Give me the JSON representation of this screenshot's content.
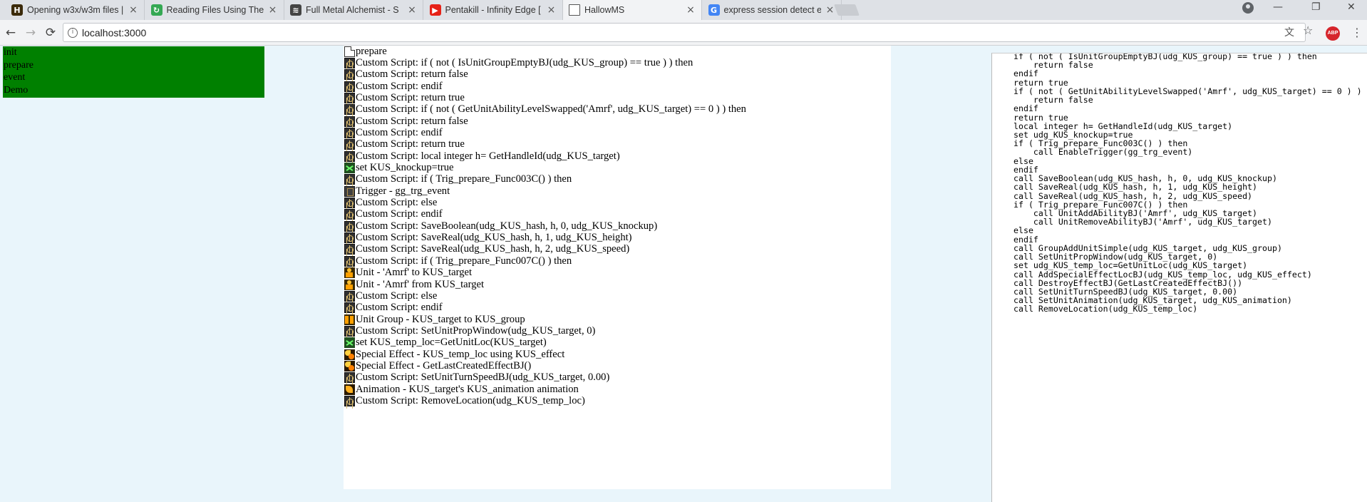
{
  "browser": {
    "tabs": [
      {
        "title": "Opening w3x/w3m files |",
        "favicon": "hive-icon",
        "color": "#3b2a0a",
        "glyph": "H",
        "active": false
      },
      {
        "title": "Reading Files Using The I",
        "favicon": "refresh-green-icon",
        "color": "#34a853",
        "glyph": "↻",
        "active": false
      },
      {
        "title": "Full Metal Alchemist - S",
        "favicon": "stack-icon",
        "color": "#444444",
        "glyph": "≋",
        "active": false
      },
      {
        "title": "Pentakill - Infinity Edge [",
        "favicon": "youtube-icon",
        "color": "#e62117",
        "glyph": "▶",
        "active": false
      },
      {
        "title": "HallowMS",
        "favicon": "document-icon",
        "color": "#ffffff",
        "glyph": "",
        "active": true
      },
      {
        "title": "express session detect er",
        "favicon": "google-icon",
        "color": "#4285f4",
        "glyph": "G",
        "active": false
      }
    ],
    "close_glyph": "×",
    "url": "localhost:3000",
    "back_glyph": "←",
    "forward_glyph": "→",
    "reload_glyph": "⟳",
    "translate_glyph": "文",
    "star_glyph": "☆",
    "abp_label": "ABP",
    "menu_glyph": "⋮",
    "minimize_glyph": "—",
    "restore_glyph": "❐",
    "window_close_glyph": "✕"
  },
  "trigger_menu": {
    "items": [
      "init",
      "prepare",
      "event",
      "Demo"
    ]
  },
  "actions": [
    {
      "icon": "page",
      "text": "prepare"
    },
    {
      "icon": "script",
      "text": "Custom Script: if ( not ( IsUnitGroupEmptyBJ(udg_KUS_group) == true ) ) then"
    },
    {
      "icon": "script",
      "text": "Custom Script: return false"
    },
    {
      "icon": "script",
      "text": "Custom Script: endif"
    },
    {
      "icon": "script",
      "text": "Custom Script: return true"
    },
    {
      "icon": "script",
      "text": "Custom Script: if ( not ( GetUnitAbilityLevelSwapped('Amrf', udg_KUS_target) == 0 ) ) then"
    },
    {
      "icon": "script",
      "text": "Custom Script: return false"
    },
    {
      "icon": "script",
      "text": "Custom Script: endif"
    },
    {
      "icon": "script",
      "text": "Custom Script: return true"
    },
    {
      "icon": "script",
      "text": "Custom Script: local integer h= GetHandleId(udg_KUS_target)"
    },
    {
      "icon": "setvar",
      "text": " set KUS_knockup=true"
    },
    {
      "icon": "script",
      "text": "Custom Script: if ( Trig_prepare_Func003C() ) then"
    },
    {
      "icon": "trigger",
      "text": "Trigger - gg_trg_event"
    },
    {
      "icon": "script",
      "text": "Custom Script: else"
    },
    {
      "icon": "script",
      "text": "Custom Script: endif"
    },
    {
      "icon": "script",
      "text": "Custom Script: SaveBoolean(udg_KUS_hash, h, 0, udg_KUS_knockup)"
    },
    {
      "icon": "script",
      "text": "Custom Script: SaveReal(udg_KUS_hash, h, 1, udg_KUS_height)"
    },
    {
      "icon": "script",
      "text": "Custom Script: SaveReal(udg_KUS_hash, h, 2, udg_KUS_speed)"
    },
    {
      "icon": "script",
      "text": "Custom Script: if ( Trig_prepare_Func007C() ) then"
    },
    {
      "icon": "unit",
      "text": "Unit - 'Amrf' to KUS_target"
    },
    {
      "icon": "unit",
      "text": "Unit - 'Amrf' from KUS_target"
    },
    {
      "icon": "script",
      "text": "Custom Script: else"
    },
    {
      "icon": "script",
      "text": "Custom Script: endif"
    },
    {
      "icon": "group",
      "text": "Unit Group - KUS_target to KUS_group"
    },
    {
      "icon": "script",
      "text": "Custom Script: SetUnitPropWindow(udg_KUS_target, 0)"
    },
    {
      "icon": "setvar",
      "text": " set KUS_temp_loc=GetUnitLoc(KUS_target)"
    },
    {
      "icon": "effect",
      "text": "Special Effect - KUS_temp_loc using KUS_effect"
    },
    {
      "icon": "effect",
      "text": "Special Effect - GetLastCreatedEffectBJ()"
    },
    {
      "icon": "script",
      "text": "Custom Script: SetUnitTurnSpeedBJ(udg_KUS_target, 0.00)"
    },
    {
      "icon": "anim",
      "text": "Animation - KUS_target's KUS_animation animation"
    },
    {
      "icon": "script",
      "text": "Custom Script: RemoveLocation(udg_KUS_temp_loc)"
    }
  ],
  "code_lines": [
    "if ( not ( IsUnitGroupEmptyBJ(udg_KUS_group) == true ) ) then",
    "    return false",
    "endif",
    "return true",
    "if ( not ( GetUnitAbilityLevelSwapped('Amrf', udg_KUS_target) == 0 ) ) then",
    "    return false",
    "endif",
    "return true",
    "local integer h= GetHandleId(udg_KUS_target)",
    "set udg_KUS_knockup=true",
    "if ( Trig_prepare_Func003C() ) then",
    "    call EnableTrigger(gg_trg_event)",
    "else",
    "endif",
    "call SaveBoolean(udg_KUS_hash, h, 0, udg_KUS_knockup)",
    "call SaveReal(udg_KUS_hash, h, 1, udg_KUS_height)",
    "call SaveReal(udg_KUS_hash, h, 2, udg_KUS_speed)",
    "if ( Trig_prepare_Func007C() ) then",
    "    call UnitAddAbilityBJ('Amrf', udg_KUS_target)",
    "    call UnitRemoveAbilityBJ('Amrf', udg_KUS_target)",
    "else",
    "endif",
    "call GroupAddUnitSimple(udg_KUS_target, udg_KUS_group)",
    "call SetUnitPropWindow(udg_KUS_target, 0)",
    "set udg_KUS_temp_loc=GetUnitLoc(udg_KUS_target)",
    "call AddSpecialEffectLocBJ(udg_KUS_temp_loc, udg_KUS_effect)",
    "call DestroyEffectBJ(GetLastCreatedEffectBJ())",
    "call SetUnitTurnSpeedBJ(udg_KUS_target, 0.00)",
    "call SetUnitAnimation(udg_KUS_target, udg_KUS_animation)",
    "call RemoveLocation(udg_KUS_temp_loc)"
  ]
}
